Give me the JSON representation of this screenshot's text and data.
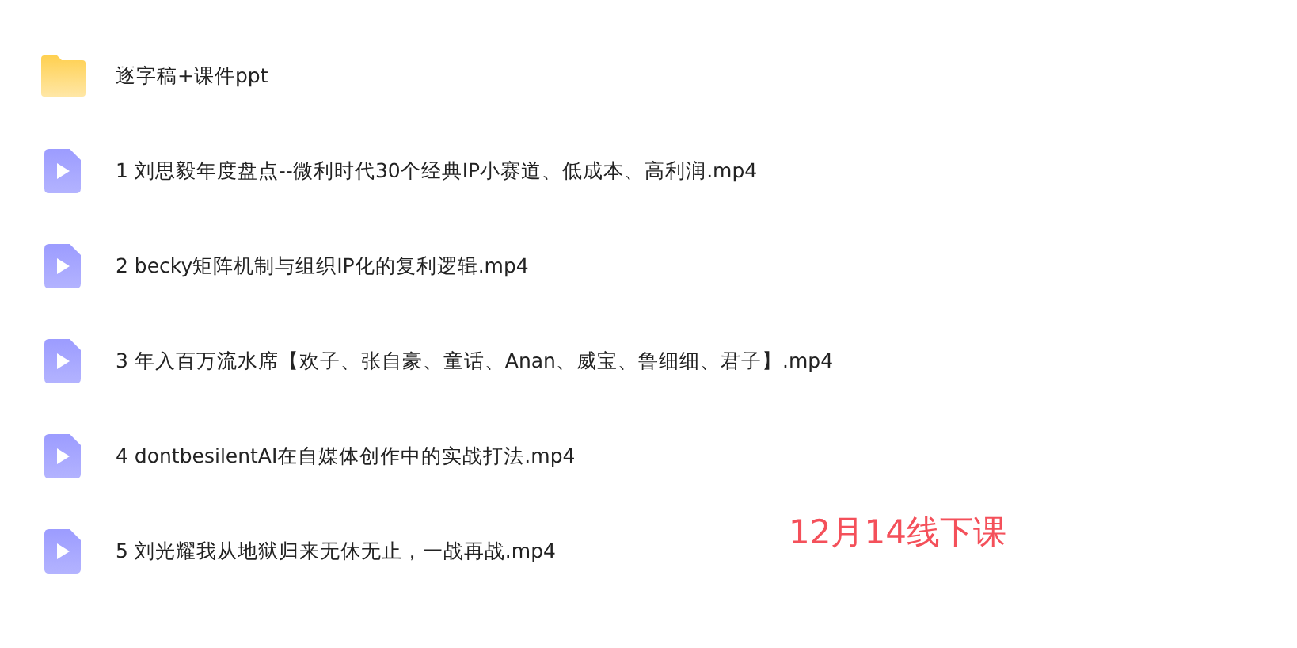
{
  "files": [
    {
      "kind": "folder",
      "name": "逐字稿+课件ppt"
    },
    {
      "kind": "video",
      "name": "1 刘思毅年度盘点--微利时代30个经典IP小赛道、低成本、高利润.mp4"
    },
    {
      "kind": "video",
      "name": "2 becky矩阵机制与组织IP化的复利逻辑.mp4"
    },
    {
      "kind": "video",
      "name": "3 年入百万流水席【欢子、张自豪、童话、Anan、威宝、鲁细细、君子】.mp4"
    },
    {
      "kind": "video",
      "name": "4 dontbesilentAI在自媒体创作中的实战打法.mp4"
    },
    {
      "kind": "video",
      "name": "5 刘光耀我从地狱归来无休无止，一战再战.mp4"
    }
  ],
  "note": "12月14线下课"
}
